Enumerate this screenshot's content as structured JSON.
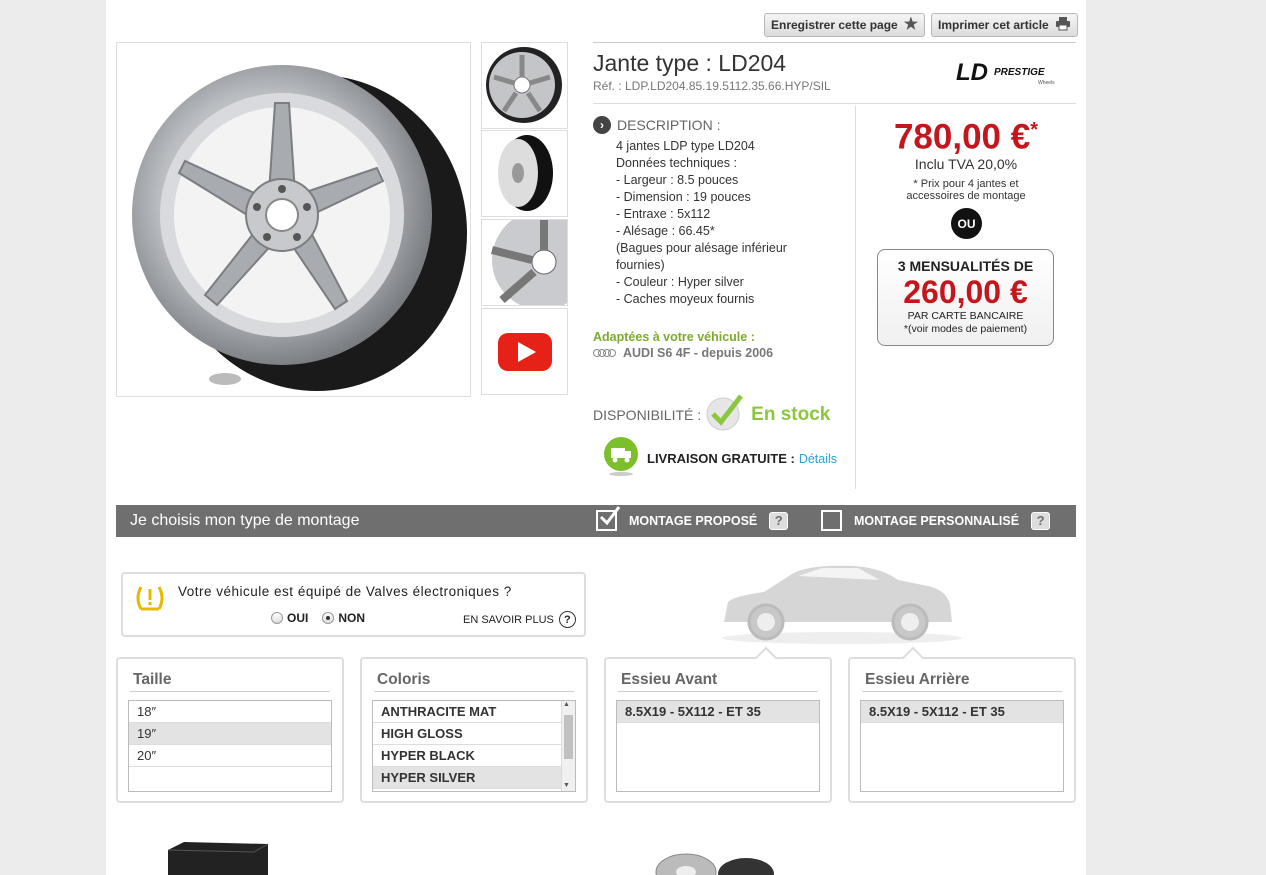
{
  "toolbar": {
    "save_label": "Enregistrer cette page",
    "print_label": "Imprimer cet article"
  },
  "product": {
    "title": "Jante type : LD204",
    "ref": "Réf. : LDP.LD204.85.19.5112.35.66.HYP/SIL",
    "brand_logo": "LDP PRESTIGE"
  },
  "description": {
    "heading": "DESCRIPTION :",
    "lines": [
      "4 jantes LDP type LD204",
      "Données techniques :",
      "- Largeur : 8.5 pouces",
      "- Dimension : 19 pouces",
      "- Entraxe : 5x112",
      "- Alésage : 66.45*",
      "(Bagues pour alésage inférieur fournies)",
      "- Couleur : Hyper silver",
      "- Caches moyeux fournis"
    ]
  },
  "compat": {
    "title": "Adaptées à votre véhicule :",
    "vehicle": "AUDI S6 4F - depuis 2006"
  },
  "availability": {
    "label": "DISPONIBILITÉ :",
    "value": "En stock",
    "color": "#8cc63f"
  },
  "delivery": {
    "label": "LIVRAISON GRATUITE :",
    "link": "Détails"
  },
  "price": {
    "value": "780,00 €",
    "star": "*",
    "tva": "Inclu TVA 20,0%",
    "note": "* Prix pour 4 jantes et accessoires de montage",
    "or": "OU",
    "installments_title": "3 MENSUALITÉS DE",
    "installment_value": "260,00 €",
    "installment_sub": "PAR CARTE BANCAIRE",
    "installment_note": "*(voir modes de paiement)",
    "color": "#c4161c"
  },
  "mounting": {
    "title": "Je choisis mon type de montage",
    "option_proposed": "MONTAGE PROPOSÉ",
    "option_custom": "MONTAGE PERSONNALISÉ",
    "help": "?"
  },
  "valves": {
    "question": "Votre véhicule est équipé de Valves électroniques ?",
    "yes": "OUI",
    "no": "NON",
    "more": "EN SAVOIR PLUS",
    "selected": "NON"
  },
  "panels": {
    "size": {
      "title": "Taille",
      "options": [
        "18″",
        "19″",
        "20″"
      ],
      "selected": "19″"
    },
    "color": {
      "title": "Coloris",
      "options": [
        "ANTHRACITE MAT",
        "HIGH GLOSS",
        "HYPER BLACK",
        "HYPER SILVER"
      ],
      "selected": "HYPER SILVER"
    },
    "front": {
      "title": "Essieu Avant",
      "options": [
        "8.5X19 - 5X112 - ET 35"
      ],
      "selected": "8.5X19 - 5X112 - ET 35"
    },
    "rear": {
      "title": "Essieu Arrière",
      "options": [
        "8.5X19 - 5X112 - ET 35"
      ],
      "selected": "8.5X19 - 5X112 - ET 35"
    }
  }
}
